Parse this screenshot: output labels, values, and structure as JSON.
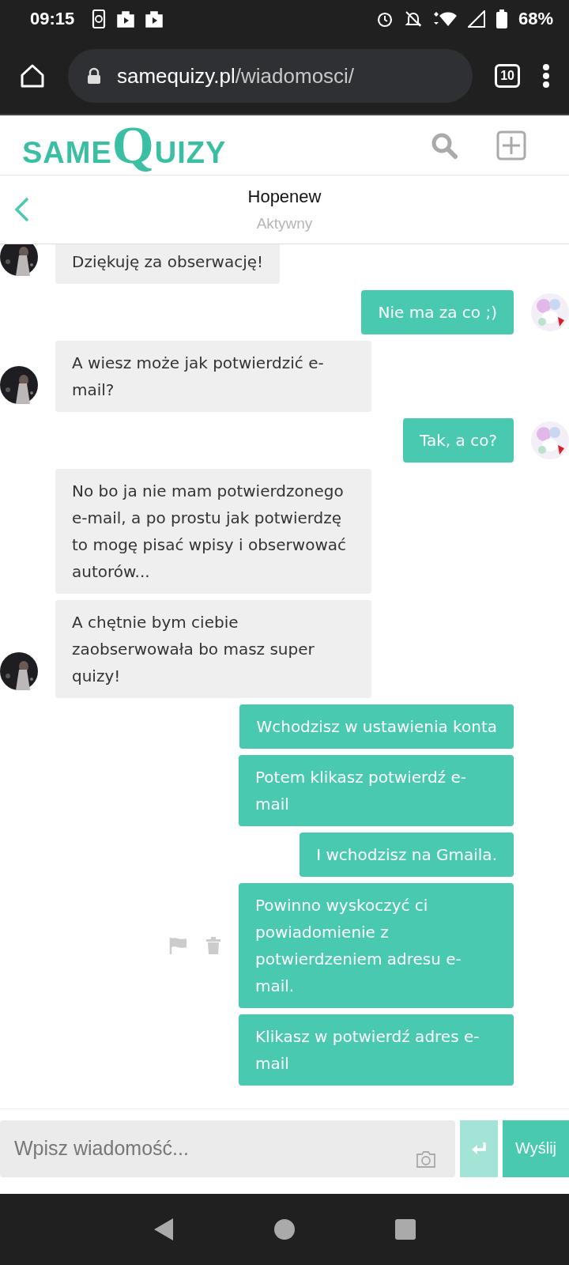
{
  "status_bar": {
    "time": "09:15",
    "battery": "68%"
  },
  "browser": {
    "url_host": "samequizy.pl",
    "url_path": "/wiadomosci/",
    "tab_count": "10"
  },
  "site": {
    "logo_first": "SAME",
    "logo_initial": "Q",
    "logo_rest": "UIZY"
  },
  "chat": {
    "name": "Hopenew",
    "status": "Aktywny"
  },
  "messages": [
    {
      "kind": "incoming",
      "text": "Dziękuję za obserwację!",
      "avatar": true,
      "actions": false
    },
    {
      "kind": "outgoing",
      "text": "Nie ma za co ;)",
      "avatar": true,
      "actions": false
    },
    {
      "kind": "incoming",
      "text": "A wiesz może jak potwierdzić e-mail?",
      "avatar": true,
      "actions": false
    },
    {
      "kind": "outgoing",
      "text": "Tak, a co?",
      "avatar": true,
      "actions": false
    },
    {
      "kind": "incoming",
      "text": "No bo ja nie mam potwierdzonego e-mail, a po prostu jak potwierdzę to mogę pisać wpisy i obserwować autorów...",
      "avatar": false,
      "actions": false
    },
    {
      "kind": "incoming",
      "text": "A chętnie bym ciebie zaobserwowała bo masz super quizy!",
      "avatar": true,
      "actions": false
    },
    {
      "kind": "outgoing",
      "text": "Wchodzisz w ustawienia konta",
      "avatar": false,
      "actions": false
    },
    {
      "kind": "outgoing",
      "text": "Potem klikasz potwierdź e-mail",
      "avatar": false,
      "actions": false
    },
    {
      "kind": "outgoing",
      "text": "I wchodzisz na Gmaila.",
      "avatar": false,
      "actions": false
    },
    {
      "kind": "outgoing",
      "text": "Powinno wyskoczyć ci powiadomienie z potwierdzeniem adresu e-mail.",
      "avatar": false,
      "actions": true
    },
    {
      "kind": "outgoing",
      "text": "Klikasz w potwierdź adres e-mail",
      "avatar": false,
      "actions": false
    }
  ],
  "composer": {
    "placeholder": "Wpisz wiadomość...",
    "send_label": "Wyślij"
  }
}
